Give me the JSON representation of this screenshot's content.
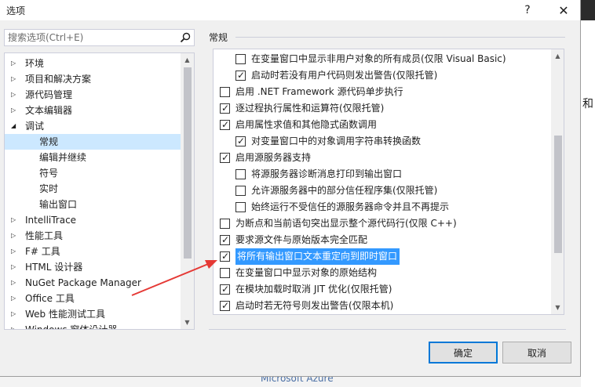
{
  "window": {
    "title": "选项",
    "help_label": "?",
    "close_label": "✕"
  },
  "search": {
    "placeholder": "搜索选项(Ctrl+E)"
  },
  "tree": {
    "items": [
      {
        "label": "环境",
        "level": 0,
        "expander": "collapsed"
      },
      {
        "label": "项目和解决方案",
        "level": 0,
        "expander": "collapsed"
      },
      {
        "label": "源代码管理",
        "level": 0,
        "expander": "collapsed"
      },
      {
        "label": "文本编辑器",
        "level": 0,
        "expander": "collapsed"
      },
      {
        "label": "调试",
        "level": 0,
        "expander": "expanded"
      },
      {
        "label": "常规",
        "level": 1,
        "selected": true
      },
      {
        "label": "编辑并继续",
        "level": 1
      },
      {
        "label": "符号",
        "level": 1
      },
      {
        "label": "实时",
        "level": 1
      },
      {
        "label": "输出窗口",
        "level": 1
      },
      {
        "label": "IntelliTrace",
        "level": 0,
        "expander": "collapsed"
      },
      {
        "label": "性能工具",
        "level": 0,
        "expander": "collapsed"
      },
      {
        "label": "F# 工具",
        "level": 0,
        "expander": "collapsed"
      },
      {
        "label": "HTML 设计器",
        "level": 0,
        "expander": "collapsed"
      },
      {
        "label": "NuGet Package Manager",
        "level": 0,
        "expander": "collapsed"
      },
      {
        "label": "Office 工具",
        "level": 0,
        "expander": "collapsed"
      },
      {
        "label": "Web 性能测试工具",
        "level": 0,
        "expander": "collapsed"
      },
      {
        "label": "Windows 窗体设计器",
        "level": 0,
        "expander": "collapsed"
      }
    ]
  },
  "section": {
    "title": "常规"
  },
  "options": [
    {
      "label": "在变量窗口中显示非用户对象的所有成员(仅限 Visual Basic)",
      "checked": false,
      "indent": 1
    },
    {
      "label": "启动时若没有用户代码则发出警告(仅限托管)",
      "checked": true,
      "indent": 1
    },
    {
      "label": "启用 .NET Framework 源代码单步执行",
      "checked": false,
      "indent": 0
    },
    {
      "label": "逐过程执行属性和运算符(仅限托管)",
      "checked": true,
      "indent": 0
    },
    {
      "label": "启用属性求值和其他隐式函数调用",
      "checked": true,
      "indent": 0
    },
    {
      "label": "对变量窗口中的对象调用字符串转换函数",
      "checked": true,
      "indent": 1
    },
    {
      "label": "启用源服务器支持",
      "checked": true,
      "indent": 0
    },
    {
      "label": "将源服务器诊断消息打印到输出窗口",
      "checked": false,
      "indent": 1
    },
    {
      "label": "允许源服务器中的部分信任程序集(仅限托管)",
      "checked": false,
      "indent": 1
    },
    {
      "label": "始终运行不受信任的源服务器命令并且不再提示",
      "checked": false,
      "indent": 1
    },
    {
      "label": "为断点和当前语句突出显示整个源代码行(仅限 C++)",
      "checked": false,
      "indent": 0
    },
    {
      "label": "要求源文件与原始版本完全匹配",
      "checked": true,
      "indent": 0
    },
    {
      "label": "将所有输出窗口文本重定向到即时窗口",
      "checked": true,
      "indent": 0,
      "highlighted": true
    },
    {
      "label": "在变量窗口中显示对象的原始结构",
      "checked": false,
      "indent": 0
    },
    {
      "label": "在模块加载时取消 JIT 优化(仅限托管)",
      "checked": true,
      "indent": 0
    },
    {
      "label": "启动时若无符号则发出警告(仅限本机)",
      "checked": true,
      "indent": 0
    }
  ],
  "buttons": {
    "ok_label": "确定",
    "cancel_label": "取消"
  },
  "background": {
    "right_fragment": "和",
    "bottom_fragment": "Microsoft Azure"
  },
  "colors": {
    "selection": "#cce8ff",
    "highlight": "#3399ff",
    "annotation_arrow": "#e53935",
    "ok_border": "#0078d7"
  }
}
